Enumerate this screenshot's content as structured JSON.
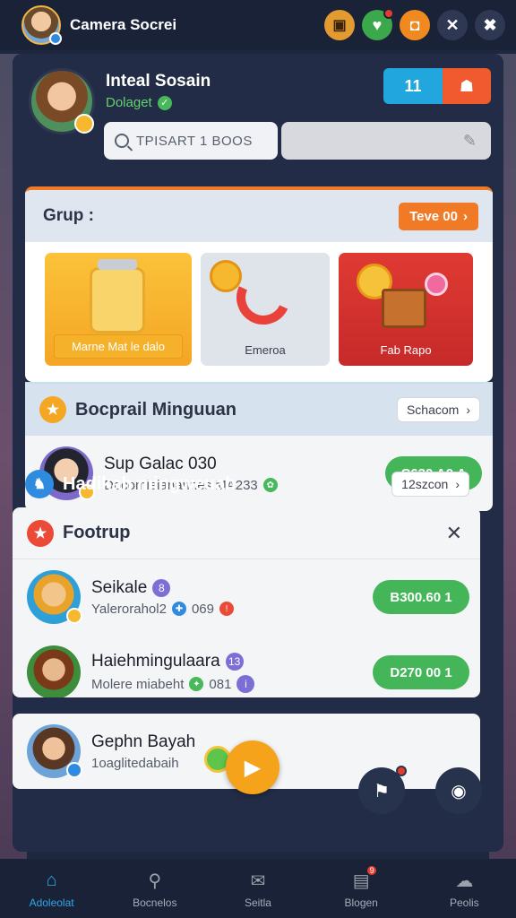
{
  "app": {
    "title": "Camera Socrei"
  },
  "topbar": {
    "icons": [
      "profile-card-icon",
      "shield-icon",
      "orange-badge-icon",
      "close-icon",
      "x-icon"
    ]
  },
  "profile": {
    "name": "Inteal Sosain",
    "status": "Dolaget",
    "header_btn_count": "11",
    "search_placeholder": "TPISART 1 BOOS"
  },
  "group": {
    "title": "Grup :",
    "action": "Teve 00",
    "tiles": [
      {
        "label": "Marne Mat le dalo"
      },
      {
        "label": "Emeroa"
      },
      {
        "label": "Fab Rapo"
      }
    ]
  },
  "social": {
    "title": "Bocprail Minguuan",
    "action": "Schacom",
    "row": {
      "name": "Sup Galac 030",
      "sub": "Docomleianannes MA233",
      "button": "C630 A0 A"
    }
  },
  "section2": {
    "title": "Hadikah mingweuah",
    "action": "12szcon"
  },
  "footrup": {
    "title": "Footrup",
    "rows": [
      {
        "name": "Seikale",
        "badge": "8",
        "sub": "Yalerorahol2",
        "sub_count": "069",
        "button": "B300.60 1"
      },
      {
        "name": "Haiehmingulaara",
        "badge": "13",
        "sub": "Molere miabeht",
        "sub_count": "081",
        "button": "D270 00 1"
      }
    ]
  },
  "notification": {
    "name": "Gephn Bayah",
    "sub": "1oaglitedabaih"
  },
  "nav": {
    "items": [
      {
        "label": "Adoleolat",
        "icon": "home-icon",
        "active": true
      },
      {
        "label": "Bocnelos",
        "icon": "search-people-icon",
        "active": false
      },
      {
        "label": "Seitla",
        "icon": "chat-icon",
        "active": false
      },
      {
        "label": "Blogen",
        "icon": "document-icon",
        "badge": "9",
        "active": false
      },
      {
        "label": "Peolis",
        "icon": "cloud-icon",
        "active": false
      }
    ]
  },
  "colors": {
    "accent_orange": "#f07a26",
    "accent_green": "#45b559",
    "accent_blue": "#21a7de",
    "panel_dark": "#222c46"
  }
}
